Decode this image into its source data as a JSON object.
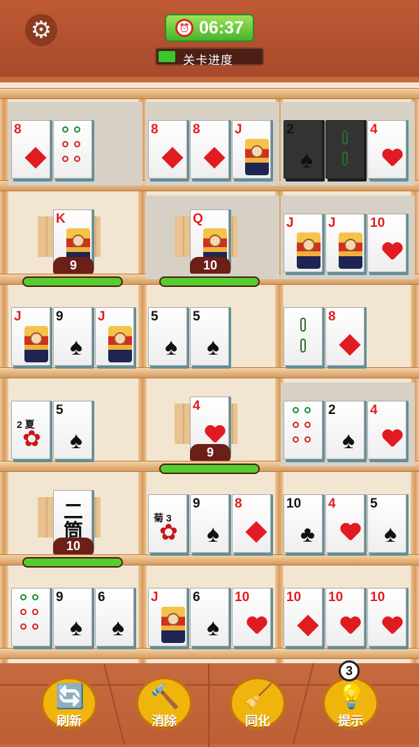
{
  "header": {
    "timer": "06:37",
    "progress_label": "关卡进度",
    "settings_icon": "gear-icon",
    "timer_icon": "alarm-clock-icon"
  },
  "shelves": [
    {
      "name": "r1c1",
      "tiles": [
        {
          "rank": "8",
          "suit": "diamond"
        },
        {
          "rank": "",
          "suit": "mahjong-dots"
        }
      ]
    },
    {
      "name": "r1c2",
      "tiles": [
        {
          "rank": "8",
          "suit": "diamond"
        },
        {
          "rank": "8",
          "suit": "diamond"
        },
        {
          "rank": "J",
          "suit": "diamond-face"
        }
      ]
    },
    {
      "name": "r1c3",
      "tiles": [
        {
          "rank": "2",
          "suit": "spade-dark"
        },
        {
          "rank": "",
          "suit": "bamboo-dark"
        },
        {
          "rank": "4",
          "suit": "heart"
        }
      ]
    },
    {
      "name": "r2c1",
      "tiles": [
        {
          "rank": "K",
          "suit": "heart-face"
        }
      ],
      "hidden_count": "9"
    },
    {
      "name": "r2c2",
      "tiles": [
        {
          "rank": "Q",
          "suit": "heart-face"
        }
      ],
      "hidden_count": "10"
    },
    {
      "name": "r2c3",
      "tiles": [
        {
          "rank": "J",
          "suit": "heart-face"
        },
        {
          "rank": "J",
          "suit": "heart-face"
        },
        {
          "rank": "10",
          "suit": "heart"
        }
      ]
    },
    {
      "name": "r3c1",
      "tiles": [
        {
          "rank": "J",
          "suit": "heart-face"
        },
        {
          "rank": "9",
          "suit": "spade"
        },
        {
          "rank": "J",
          "suit": "heart-face"
        }
      ]
    },
    {
      "name": "r3c2",
      "tiles": [
        {
          "rank": "5",
          "suit": "spade"
        },
        {
          "rank": "5",
          "suit": "spade"
        }
      ]
    },
    {
      "name": "r3c3",
      "tiles": [
        {
          "rank": "",
          "suit": "bamboo"
        },
        {
          "rank": "8",
          "suit": "diamond"
        }
      ]
    },
    {
      "name": "r4c1",
      "tiles": [
        {
          "rank": "2 夏",
          "suit": "flower"
        },
        {
          "rank": "5",
          "suit": "spade"
        }
      ]
    },
    {
      "name": "r4c2",
      "tiles": [
        {
          "rank": "4",
          "suit": "heart"
        }
      ],
      "hidden_count": "9"
    },
    {
      "name": "r4c3",
      "tiles": [
        {
          "rank": "",
          "suit": "mahjong-dots"
        },
        {
          "rank": "2",
          "suit": "spade"
        },
        {
          "rank": "4",
          "suit": "heart"
        }
      ]
    },
    {
      "name": "r5c1",
      "tiles": [
        {
          "rank": "二\n筒",
          "suit": "chinese"
        }
      ],
      "hidden_count": "10"
    },
    {
      "name": "r5c2",
      "tiles": [
        {
          "rank": "菊 3",
          "suit": "flower"
        },
        {
          "rank": "9",
          "suit": "spade"
        },
        {
          "rank": "8",
          "suit": "diamond"
        }
      ]
    },
    {
      "name": "r5c3",
      "tiles": [
        {
          "rank": "10",
          "suit": "club"
        },
        {
          "rank": "4",
          "suit": "heart"
        },
        {
          "rank": "5",
          "suit": "spade"
        }
      ]
    },
    {
      "name": "r6c1",
      "tiles": [
        {
          "rank": "",
          "suit": "mahjong-dots"
        },
        {
          "rank": "9",
          "suit": "spade"
        },
        {
          "rank": "6",
          "suit": "spade"
        }
      ]
    },
    {
      "name": "r6c2",
      "tiles": [
        {
          "rank": "J",
          "suit": "heart-face"
        },
        {
          "rank": "6",
          "suit": "spade"
        },
        {
          "rank": "10",
          "suit": "heart"
        }
      ]
    },
    {
      "name": "r6c3",
      "tiles": [
        {
          "rank": "10",
          "suit": "diamond"
        },
        {
          "rank": "10",
          "suit": "heart"
        },
        {
          "rank": "10",
          "suit": "heart"
        }
      ]
    }
  ],
  "buttons": [
    {
      "label": "刷新",
      "icon": "refresh-icon"
    },
    {
      "label": "消除",
      "icon": "hammer-icon"
    },
    {
      "label": "同化",
      "icon": "broom-icon"
    },
    {
      "label": "提示",
      "icon": "lightbulb-icon",
      "badge": "3"
    }
  ]
}
